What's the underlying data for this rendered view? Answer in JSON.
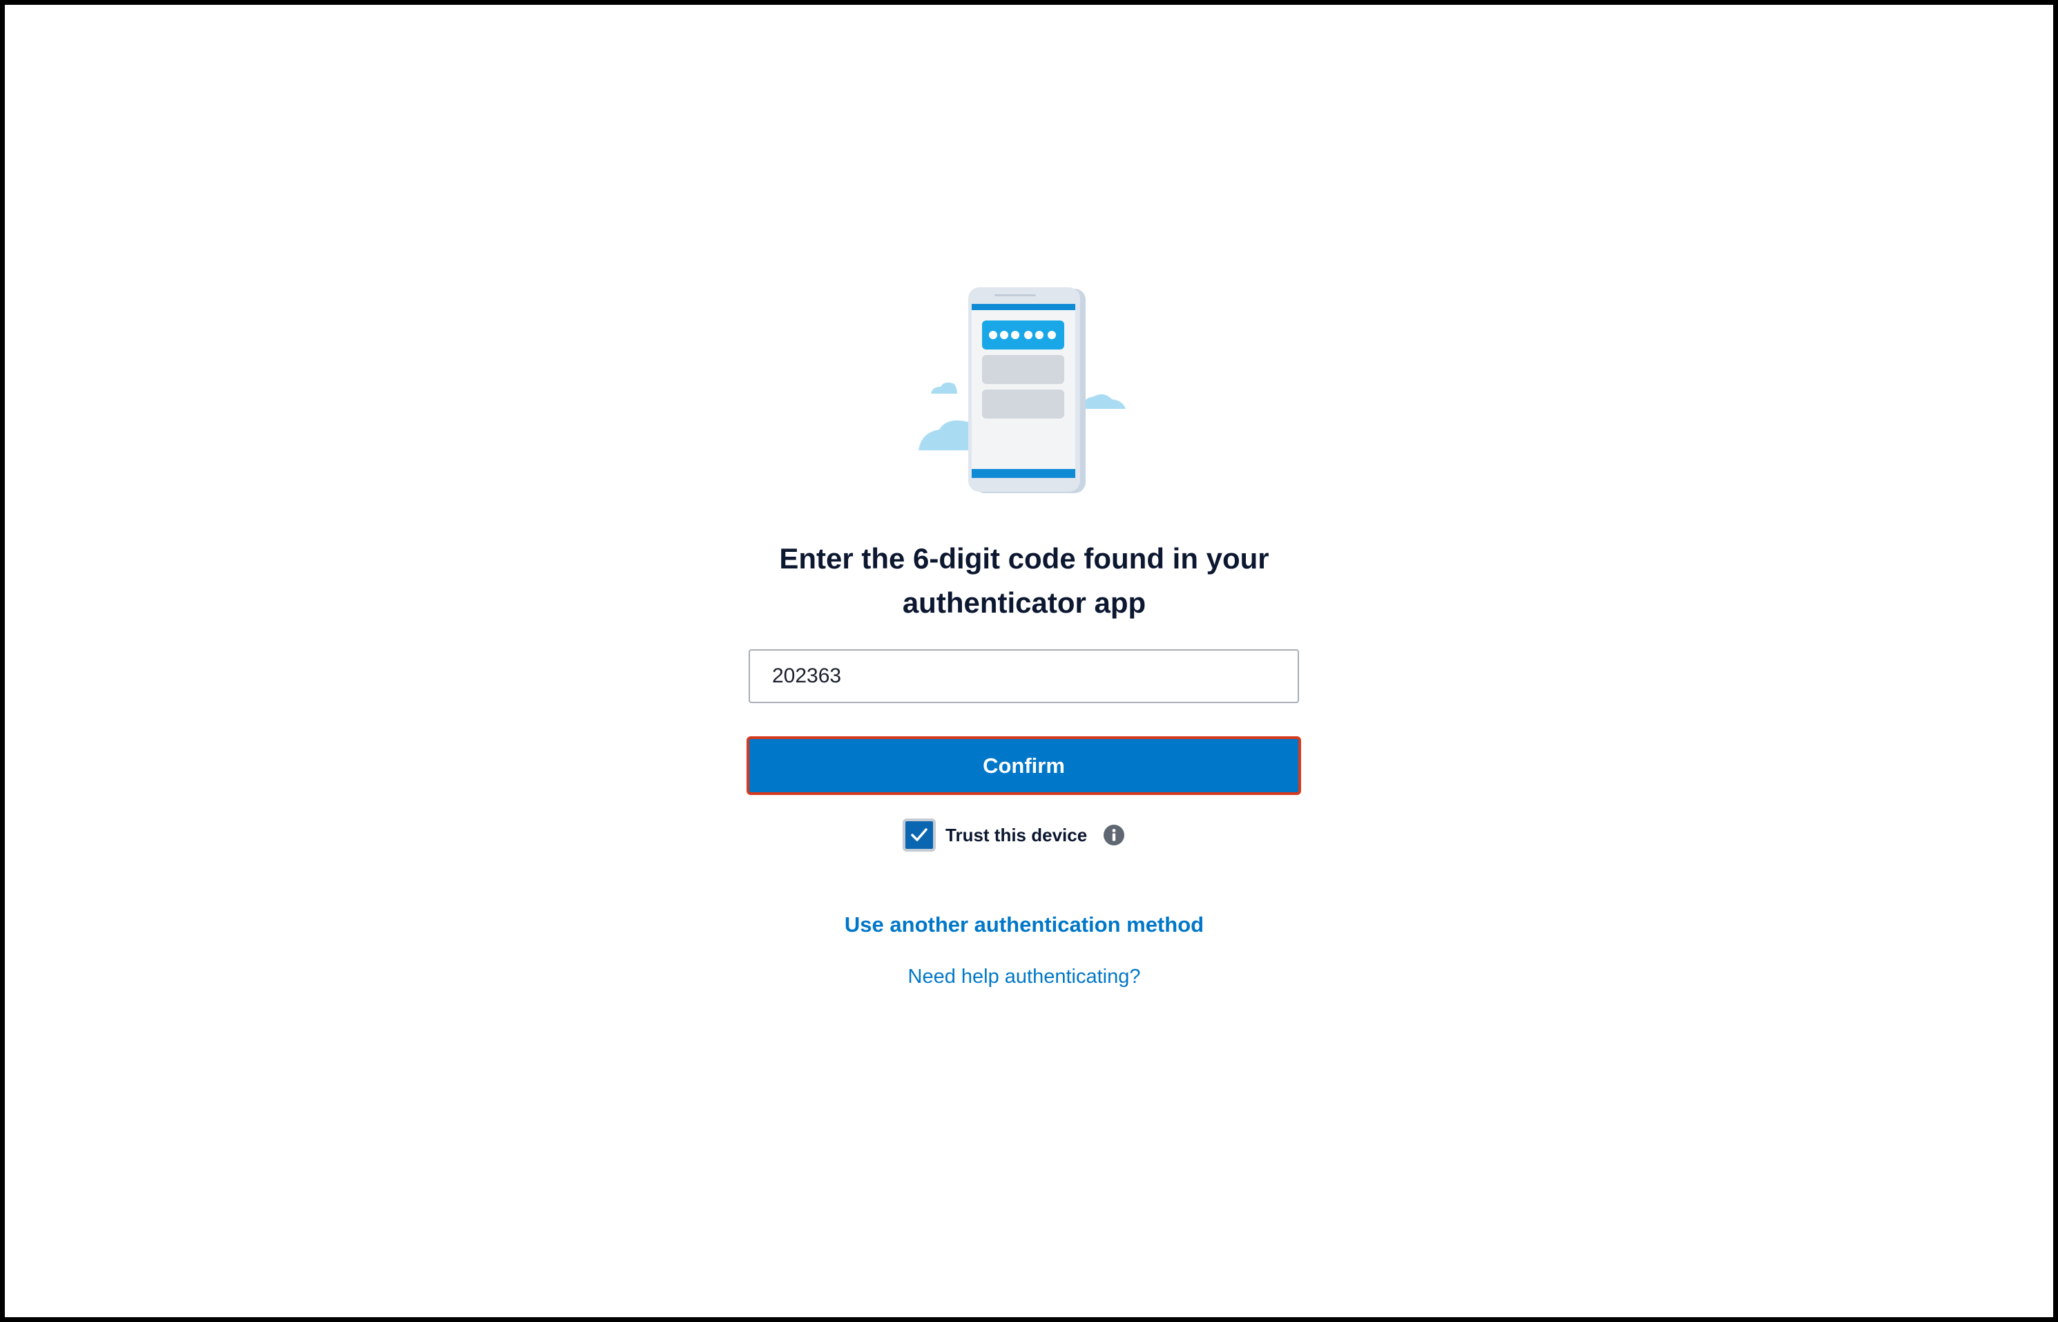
{
  "page": {
    "title": "Enter the 6-digit code found in your authenticator app"
  },
  "form": {
    "code_value": "202363",
    "confirm_label": "Confirm",
    "trust_label": "Trust this device",
    "trust_checked": true
  },
  "links": {
    "another_method": "Use another authentication method",
    "help": "Need help authenticating?"
  },
  "icons": {
    "illustration": "phone-authenticator-illustration",
    "checkbox": "check-icon",
    "info": "info-icon"
  },
  "colors": {
    "primary": "#0077c8",
    "button_border": "#d63a1e",
    "title_text": "#0c1730"
  }
}
